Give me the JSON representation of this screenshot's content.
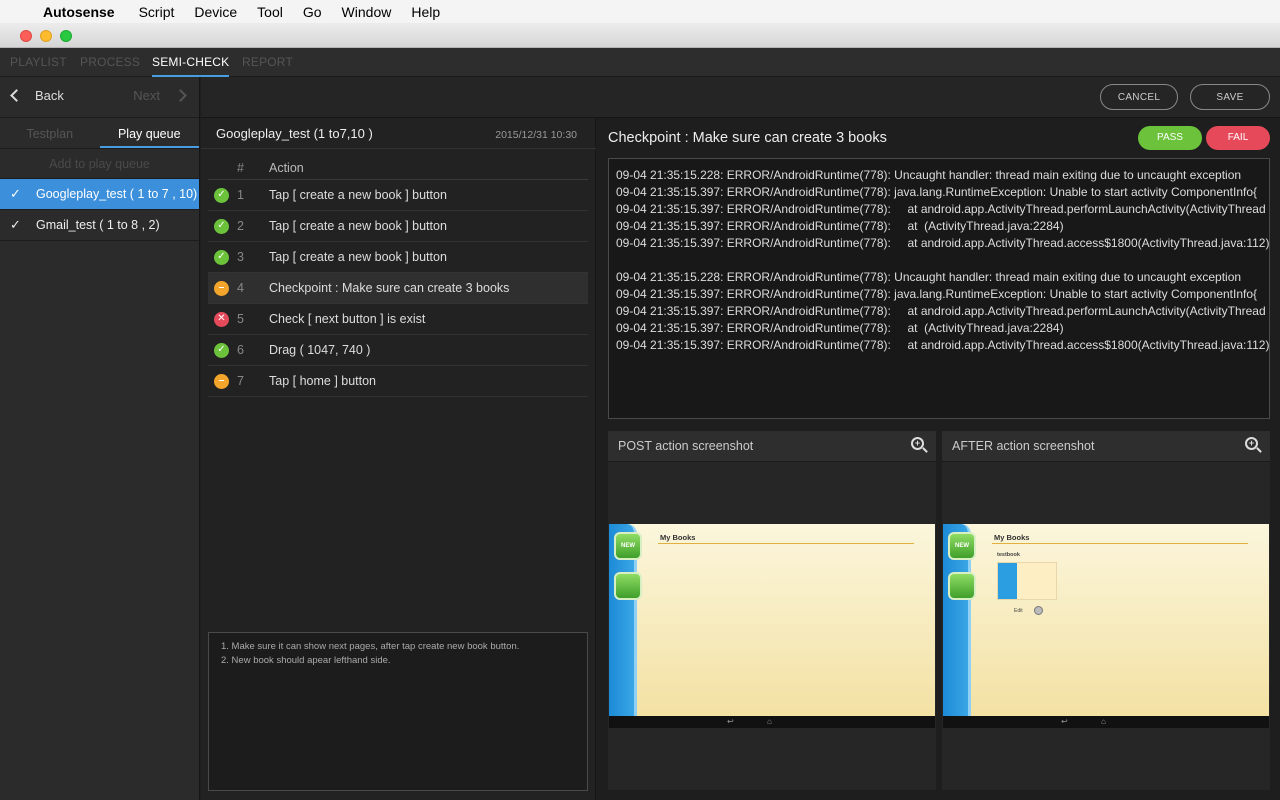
{
  "menubar": {
    "app_name": "Autosense",
    "items": [
      "Script",
      "Device",
      "Tool",
      "Go",
      "Window",
      "Help"
    ]
  },
  "main_tabs": [
    "PLAYLIST",
    "PROCESS",
    "SEMI-CHECK",
    "REPORT"
  ],
  "nav": {
    "back": "Back",
    "next": "Next"
  },
  "subtabs": [
    "Testplan",
    "Play queue"
  ],
  "add_queue": "Add to play queue",
  "queue": [
    {
      "name": "Googleplay_test ( 1 to 7 , 10)",
      "selected": true
    },
    {
      "name": "Gmail_test ( 1 to 8 , 2)",
      "selected": false
    }
  ],
  "toolbar": {
    "cancel": "CANCEL",
    "save": "SAVE"
  },
  "plan": {
    "title": "Googleplay_test (1 to7,10 )",
    "date": "2015/12/31 10:30",
    "col_num": "#",
    "col_action": "Action",
    "rows": [
      {
        "num": "1",
        "status": "pass",
        "action": "Tap [ create a new book ] button"
      },
      {
        "num": "2",
        "status": "pass",
        "action": "Tap [ create a new book ] button"
      },
      {
        "num": "3",
        "status": "pass",
        "action": "Tap [ create a new book ] button"
      },
      {
        "num": "4",
        "status": "pending",
        "action": "Checkpoint : Make sure can create 3 books"
      },
      {
        "num": "5",
        "status": "fail",
        "action": "Check [ next button ] is exist"
      },
      {
        "num": "6",
        "status": "pass",
        "action": "Drag ( 1047, 740 )"
      },
      {
        "num": "7",
        "status": "pending",
        "action": "Tap [ home ] button"
      }
    ],
    "notes": [
      "1. Make sure it can show next pages, after tap create new book button.",
      "2. New book should apear lefthand side."
    ]
  },
  "checkpoint": {
    "title": "Checkpoint : Make sure can create 3 books",
    "pass": "PASS",
    "fail": "FAIL",
    "log": [
      "09-04 21:35:15.228: ERROR/AndroidRuntime(778): Uncaught handler: thread main exiting due to uncaught exception",
      "09-04 21:35:15.397: ERROR/AndroidRuntime(778): java.lang.RuntimeException: Unable to start activity ComponentInfo{",
      "09-04 21:35:15.397: ERROR/AndroidRuntime(778):     at android.app.ActivityThread.performLaunchActivity(ActivityThread",
      "09-04 21:35:15.397: ERROR/AndroidRuntime(778):     at  (ActivityThread.java:2284)",
      "09-04 21:35:15.397: ERROR/AndroidRuntime(778):     at android.app.ActivityThread.access$1800(ActivityThread.java:112)",
      "",
      "09-04 21:35:15.228: ERROR/AndroidRuntime(778): Uncaught handler: thread main exiting due to uncaught exception",
      "09-04 21:35:15.397: ERROR/AndroidRuntime(778): java.lang.RuntimeException: Unable to start activity ComponentInfo{",
      "09-04 21:35:15.397: ERROR/AndroidRuntime(778):     at android.app.ActivityThread.performLaunchActivity(ActivityThread",
      "09-04 21:35:15.397: ERROR/AndroidRuntime(778):     at  (ActivityThread.java:2284)",
      "09-04 21:35:15.397: ERROR/AndroidRuntime(778):     at android.app.ActivityThread.access$1800(ActivityThread.java:112)"
    ]
  },
  "screenshots": {
    "post_label": "POST action screenshot",
    "after_label": "AFTER action screenshot",
    "device_title": "My Books",
    "device_book_label": "testbook",
    "device_edit_label": "Edit",
    "device_new_badge": "NEW"
  },
  "colors": {
    "accent": "#4a9ce0",
    "pass": "#6cc33b",
    "pending": "#f2a42b",
    "fail": "#e54a5b"
  },
  "icons": {
    "pass": "check-circle-icon",
    "pending": "minus-circle-icon",
    "fail": "x-circle-icon",
    "zoom": "zoom-in-icon"
  }
}
